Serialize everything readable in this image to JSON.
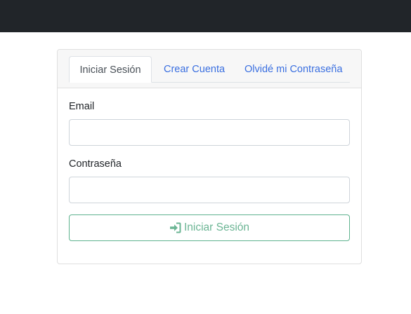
{
  "tabs": [
    {
      "label": "Iniciar Sesión",
      "active": true
    },
    {
      "label": "Crear Cuenta",
      "active": false
    },
    {
      "label": "Olvidé mi Contraseña",
      "active": false
    }
  ],
  "form": {
    "email_label": "Email",
    "email_value": "",
    "password_label": "Contraseña",
    "password_value": "",
    "submit_label": "Iniciar Sesión",
    "submit_icon": "sign-in-icon"
  },
  "colors": {
    "navbar": "#212529",
    "link": "#3a6fe0",
    "submit_accent": "#5fb38f"
  }
}
